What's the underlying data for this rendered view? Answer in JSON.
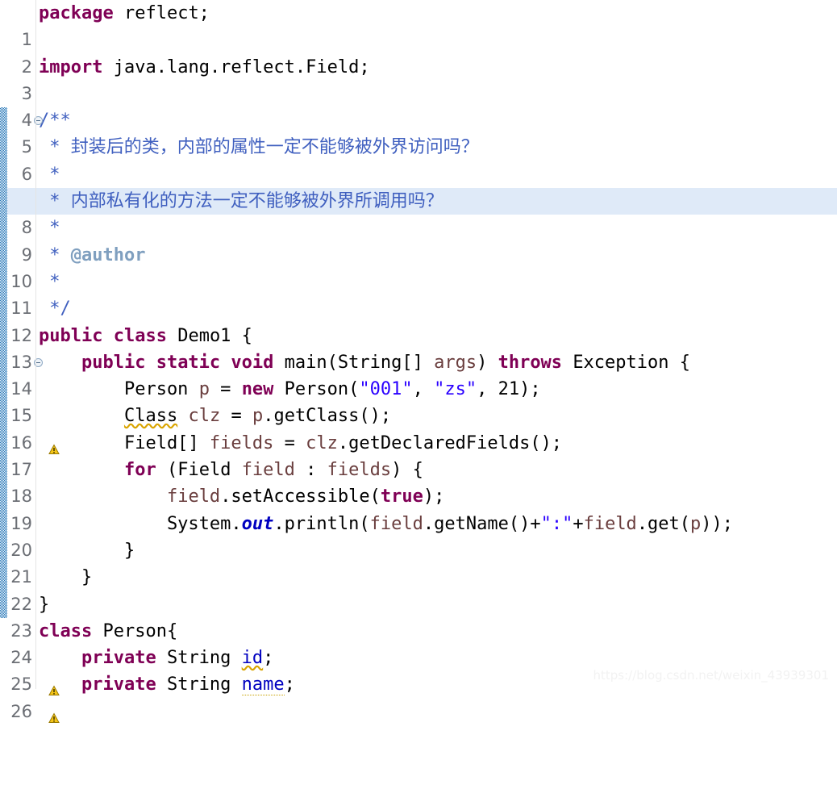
{
  "editor": {
    "language": "java",
    "current_line": 8,
    "font_size_px": 22,
    "line_height_px": 33.3,
    "background": "#ffffff",
    "current_line_highlight": "#dfeaf8",
    "gutter_number_color": "#6c6f75",
    "fold_strip_color": "#1a6fb4",
    "colors": {
      "keyword": "#7f0055",
      "string": "#2a00ff",
      "comment": "#3f5fbf",
      "comment_tag": "#7f9fbf",
      "local_var": "#6a3e3e",
      "field": "#0000c0",
      "static_field": "#0000c0",
      "plain": "#000000",
      "warning_squiggle": "#d9a400"
    }
  },
  "watermark": {
    "text": "https://blog.csdn.net/weixin_43939301"
  },
  "gutter": {
    "fold_marker_icon": "collapse-minus-circle-icon",
    "warning_icon": "warning-triangle-icon",
    "fold_marker_lines": [
      5,
      14
    ],
    "warning_lines": [
      16,
      25,
      26
    ],
    "fold_strip_range": [
      5,
      23
    ]
  },
  "lines": [
    {
      "n": 1,
      "text": "package reflect;"
    },
    {
      "n": 2,
      "text": ""
    },
    {
      "n": 3,
      "text": "import java.lang.reflect.Field;"
    },
    {
      "n": 4,
      "text": ""
    },
    {
      "n": 5,
      "text": "/**"
    },
    {
      "n": 6,
      "text": " * 封装后的类，内部的属性一定不能够被外界访问吗？"
    },
    {
      "n": 7,
      "text": " *"
    },
    {
      "n": 8,
      "text": " * 内部私有化的方法一定不能够被外界所调用吗？"
    },
    {
      "n": 9,
      "text": " *"
    },
    {
      "n": 10,
      "text": " * @author"
    },
    {
      "n": 11,
      "text": " *"
    },
    {
      "n": 12,
      "text": " */"
    },
    {
      "n": 13,
      "text": "public class Demo1 {"
    },
    {
      "n": 14,
      "text": "    public static void main(String[] args) throws Exception {"
    },
    {
      "n": 15,
      "text": "        Person p = new Person(\"001\", \"zs\", 21);"
    },
    {
      "n": 16,
      "text": "        Class clz = p.getClass();"
    },
    {
      "n": 17,
      "text": "        Field[] fields = clz.getDeclaredFields();"
    },
    {
      "n": 18,
      "text": "        for (Field field : fields) {"
    },
    {
      "n": 19,
      "text": "            field.setAccessible(true);"
    },
    {
      "n": 20,
      "text": "            System.out.println(field.getName()+\":\"+field.get(p));"
    },
    {
      "n": 21,
      "text": "        }"
    },
    {
      "n": 22,
      "text": "    }"
    },
    {
      "n": 23,
      "text": "}"
    },
    {
      "n": 24,
      "text": "class Person{"
    },
    {
      "n": 25,
      "text": "    private String id;"
    },
    {
      "n": 26,
      "text": "    private String name;"
    }
  ]
}
